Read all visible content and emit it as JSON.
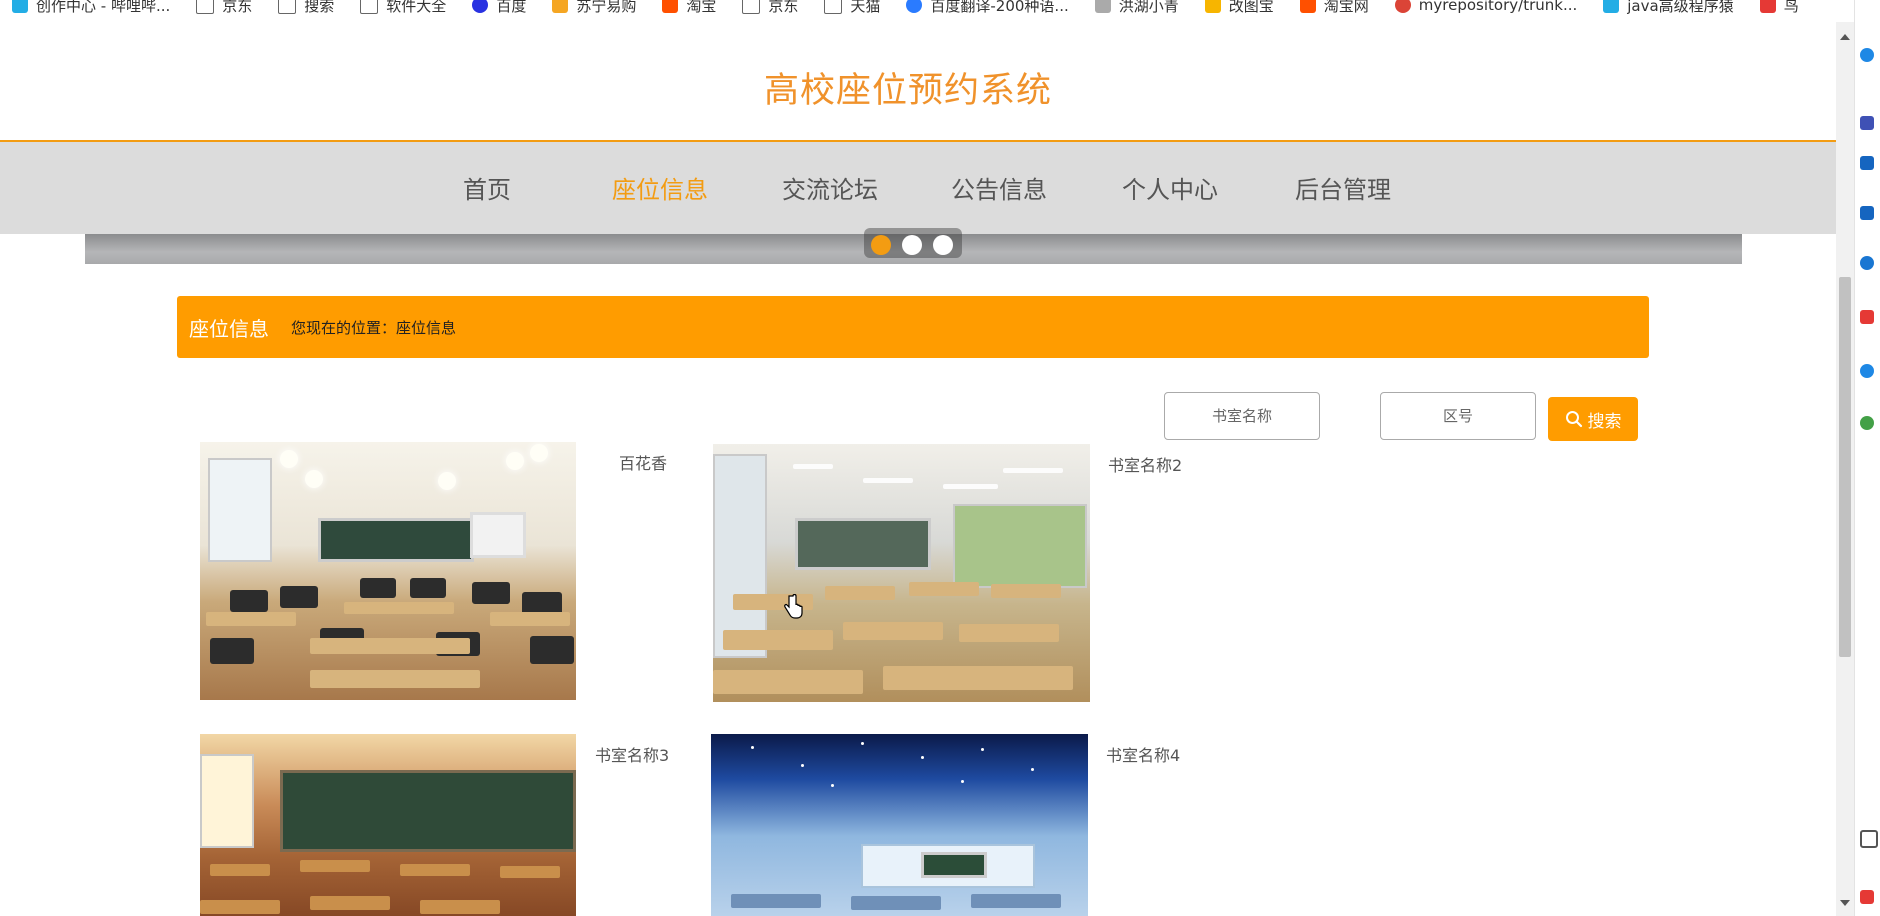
{
  "bookmarks": [
    {
      "label": "创作中心 - 哔哩哔...",
      "icon": "bilibili-icon",
      "color": "#23ade5"
    },
    {
      "label": "京东",
      "icon": "page-icon",
      "color": "#666666"
    },
    {
      "label": "搜索",
      "icon": "page-icon",
      "color": "#666666"
    },
    {
      "label": "软件大全",
      "icon": "page-icon",
      "color": "#666666"
    },
    {
      "label": "百度",
      "icon": "baidu-icon",
      "color": "#2932e1"
    },
    {
      "label": "苏宁易购",
      "icon": "suning-icon",
      "color": "#f5a623"
    },
    {
      "label": "淘宝",
      "icon": "taobao-icon",
      "color": "#ff5000"
    },
    {
      "label": "京东",
      "icon": "page-icon",
      "color": "#666666"
    },
    {
      "label": "天猫",
      "icon": "page-icon",
      "color": "#666666"
    },
    {
      "label": "百度翻译-200种语...",
      "icon": "baidu-translate-icon",
      "color": "#2a7bff"
    },
    {
      "label": "洪湖小青",
      "icon": "bird-icon",
      "color": "#aaaaaa"
    },
    {
      "label": "改图宝",
      "icon": "gaitubao-icon",
      "color": "#f7b500"
    },
    {
      "label": "淘宝网",
      "icon": "taobao-icon",
      "color": "#ff5000"
    },
    {
      "label": "myrepository/trunk...",
      "icon": "chrome-icon",
      "color": "#db4437"
    },
    {
      "label": "java高级程序猿",
      "icon": "bilibili-icon",
      "color": "#23ade5"
    },
    {
      "label": "鸟",
      "icon": "bird-red-icon",
      "color": "#e53935"
    }
  ],
  "site": {
    "title": "高校座位预约系统"
  },
  "nav": {
    "items": [
      {
        "label": "首页",
        "active": false
      },
      {
        "label": "座位信息",
        "active": true
      },
      {
        "label": "交流论坛",
        "active": false
      },
      {
        "label": "公告信息",
        "active": false
      },
      {
        "label": "个人中心",
        "active": false
      },
      {
        "label": "后台管理",
        "active": false
      }
    ]
  },
  "crumb": {
    "title": "座位信息",
    "position_label": "您现在的位置：",
    "position_value": "座位信息"
  },
  "search": {
    "room_placeholder": "书室名称",
    "zone_placeholder": "区号",
    "button_label": "搜索"
  },
  "rooms": [
    {
      "name": "百花香"
    },
    {
      "name": "书室名称2"
    },
    {
      "name": "书室名称3"
    },
    {
      "name": "书室名称4"
    }
  ],
  "colors": {
    "accent": "#ff9c00",
    "title": "#f0922b",
    "nav_bg": "#dcdcdc"
  }
}
